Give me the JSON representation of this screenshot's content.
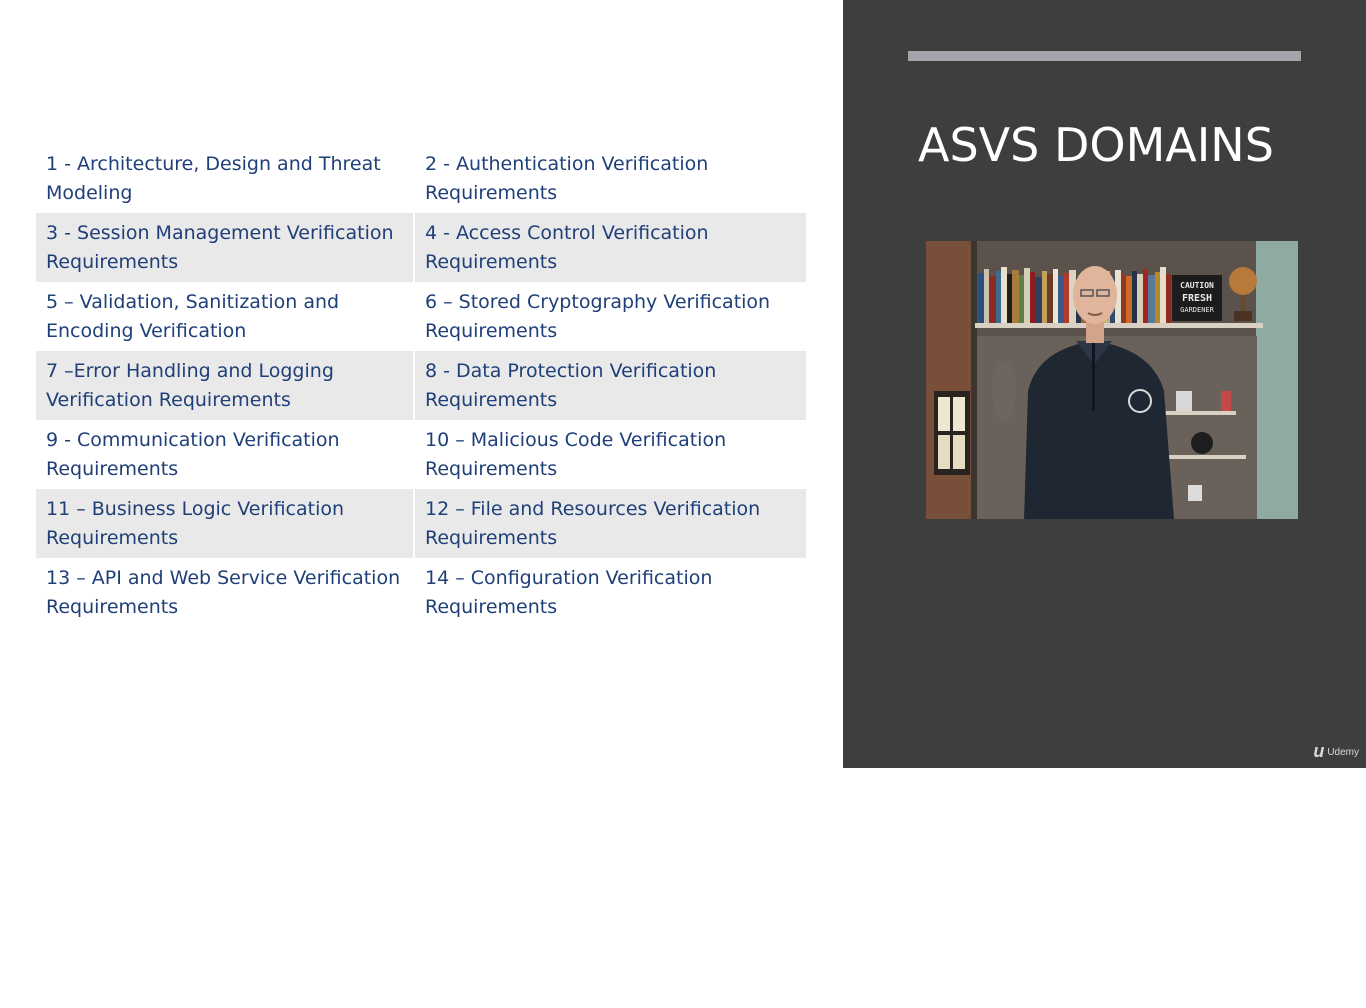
{
  "slide": {
    "title": "ASVS DOMAINS",
    "domains": [
      [
        "1 - Architecture, Design and Threat Modeling",
        "2 - Authentication Verification Requirements"
      ],
      [
        "3 - Session Management Verification Requirements",
        "4 - Access Control Verification Requirements"
      ],
      [
        "5 – Validation, Sanitization and Encoding Verification",
        "6 – Stored Cryptography Verification Requirements"
      ],
      [
        "7 –Error Handling and Logging Verification Requirements",
        "8 - Data Protection Verification Requirements"
      ],
      [
        "9 - Communication Verification Requirements",
        "10 – Malicious Code Verification Requirements"
      ],
      [
        "11 – Business Logic Verification Requirements",
        "12 – File and Resources Verification Requirements"
      ],
      [
        "13 – API and Web Service Verification Requirements",
        "14 – Configuration Verification Requirements"
      ]
    ],
    "video": {
      "sign_text": [
        "CAUTION",
        "FRESH",
        "GARDENER"
      ]
    },
    "brand": {
      "mark": "u",
      "label": "Udemy"
    }
  }
}
